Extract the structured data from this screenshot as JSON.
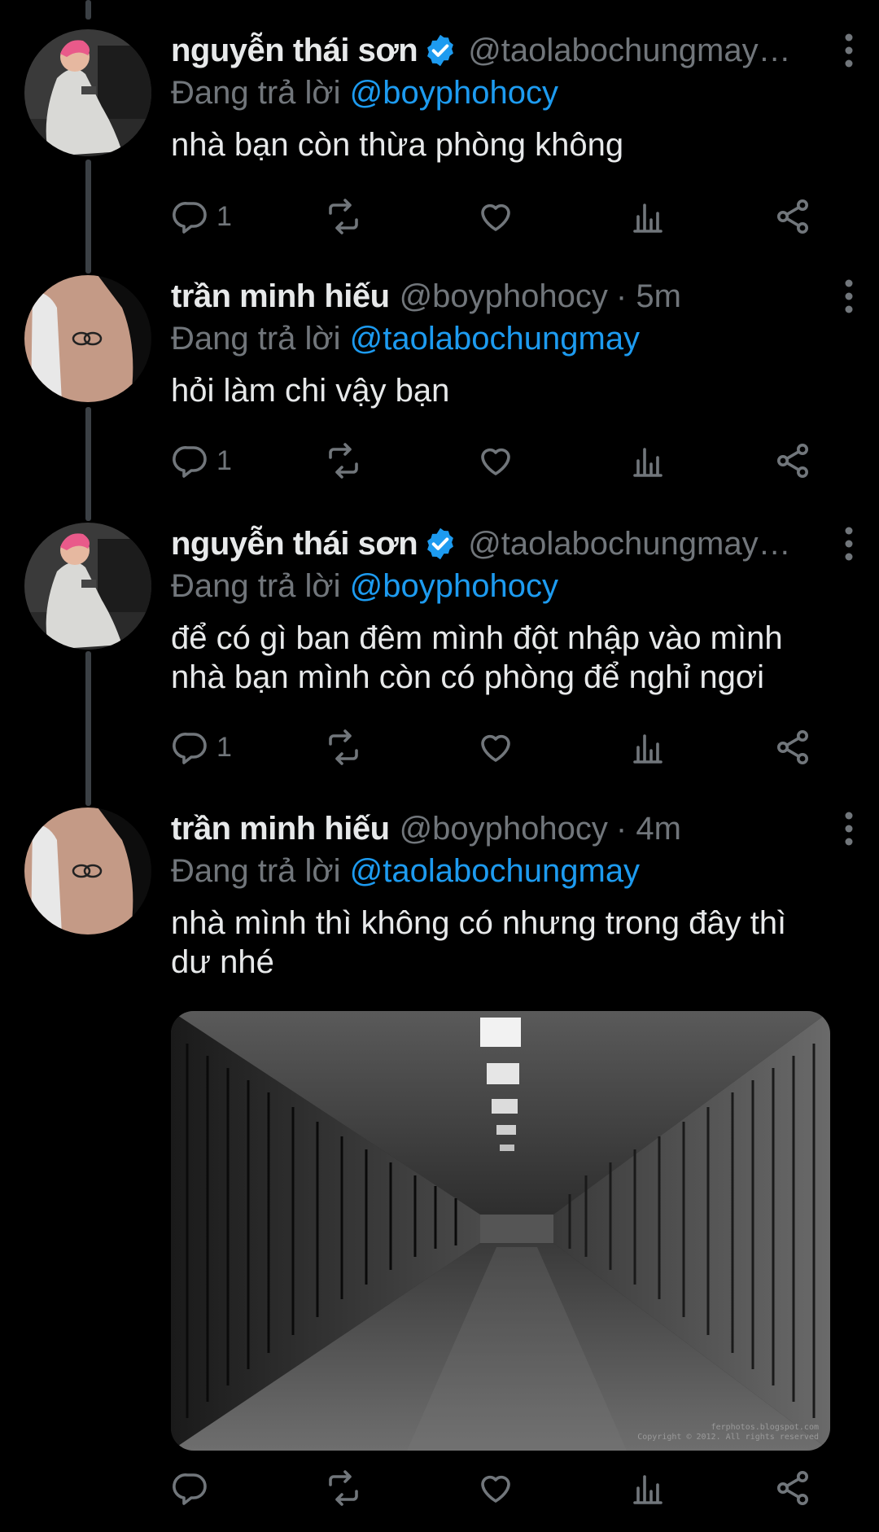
{
  "colors": {
    "background": "#000000",
    "text": "#e7e9ea",
    "muted": "#71767b",
    "accent": "#1d9bf0",
    "thread_line": "#3b4045"
  },
  "tweets": [
    {
      "name": "nguyễn thái sơn",
      "verified": true,
      "handle": "@taolabochungmay…",
      "time": "",
      "replying_label": "Đang trả lời",
      "replying_to": "@boyphohocy",
      "text": "nhà bạn còn thừa phòng không",
      "reply_count": "1",
      "avatar_icon": "avatar-pink-hair-white-outfit"
    },
    {
      "name": "trần minh hiếu",
      "verified": false,
      "handle": "@boyphohocy",
      "time": "· 5m",
      "replying_label": "Đang trả lời",
      "replying_to": "@taolabochungmay",
      "text": "hỏi làm chi vậy bạn",
      "reply_count": "1",
      "avatar_icon": "avatar-shoulder-tattoo"
    },
    {
      "name": "nguyễn thái sơn",
      "verified": true,
      "handle": "@taolabochungmay…",
      "time": "",
      "replying_label": "Đang trả lời",
      "replying_to": "@boyphohocy",
      "text": "để có gì ban đêm mình đột nhập vào mình\nnhà bạn mình còn có phòng để nghỉ ngơi",
      "reply_count": "1",
      "avatar_icon": "avatar-pink-hair-white-outfit"
    },
    {
      "name": "trần minh hiếu",
      "verified": false,
      "handle": "@boyphohocy",
      "time": "· 4m",
      "replying_label": "Đang trả lời",
      "replying_to": "@taolabochungmay",
      "text": "nhà mình thì không có nhưng trong đây thì\ndư nhé",
      "reply_count": "",
      "avatar_icon": "avatar-shoulder-tattoo",
      "media": {
        "description_icon": "prison-corridor-photo",
        "watermark_line1": "ferphotos.blogspot.com",
        "watermark_line2": "Copyright © 2012. All rights reserved"
      }
    }
  ],
  "icons": {
    "reply": "reply-icon",
    "retweet": "retweet-icon",
    "like": "like-icon",
    "analytics": "analytics-icon",
    "share": "share-icon",
    "more": "more-options-icon",
    "verified": "verified-badge-icon"
  }
}
